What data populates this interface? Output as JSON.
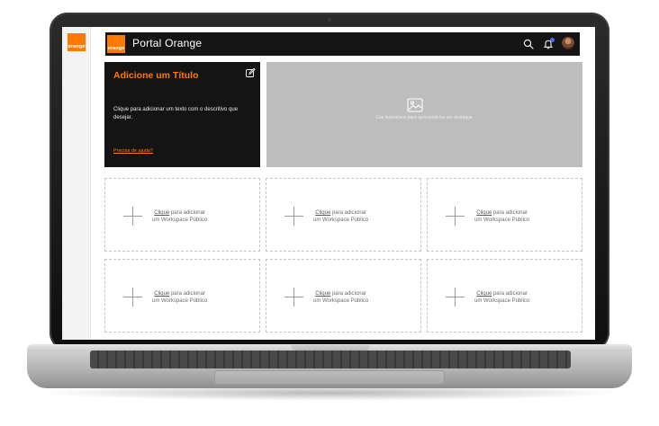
{
  "brand": {
    "logo_text": "orange",
    "accent_color": "#ff7900"
  },
  "header": {
    "logo_text": "orange",
    "title": "Portal Orange",
    "icons": [
      "search-icon",
      "bell-icon",
      "avatar"
    ]
  },
  "intro_card": {
    "title": "Adicione um Título",
    "description": "Clique para adicionar um texto com o descritivo que desejar.",
    "help_link": "Precisa de ajuda?"
  },
  "image_slot": {
    "caption": "Crie ilustrativos para apresentá-los em destaque"
  },
  "workspace_cards": [
    {
      "link": "Clique",
      "line1_rest": " para adicionar",
      "line2": "um Workspace Público"
    },
    {
      "link": "Clique",
      "line1_rest": " para adicionar",
      "line2": "um Workspace Público"
    },
    {
      "link": "Clique",
      "line1_rest": " para adicionar",
      "line2": "um Workspace Público"
    },
    {
      "link": "Clique",
      "line1_rest": " para adicionar",
      "line2": "um Workspace Público"
    },
    {
      "link": "Clique",
      "line1_rest": " para adicionar",
      "line2": "um Workspace Público"
    },
    {
      "link": "Clique",
      "line1_rest": " para adicionar",
      "line2": "um Workspace Público"
    }
  ]
}
